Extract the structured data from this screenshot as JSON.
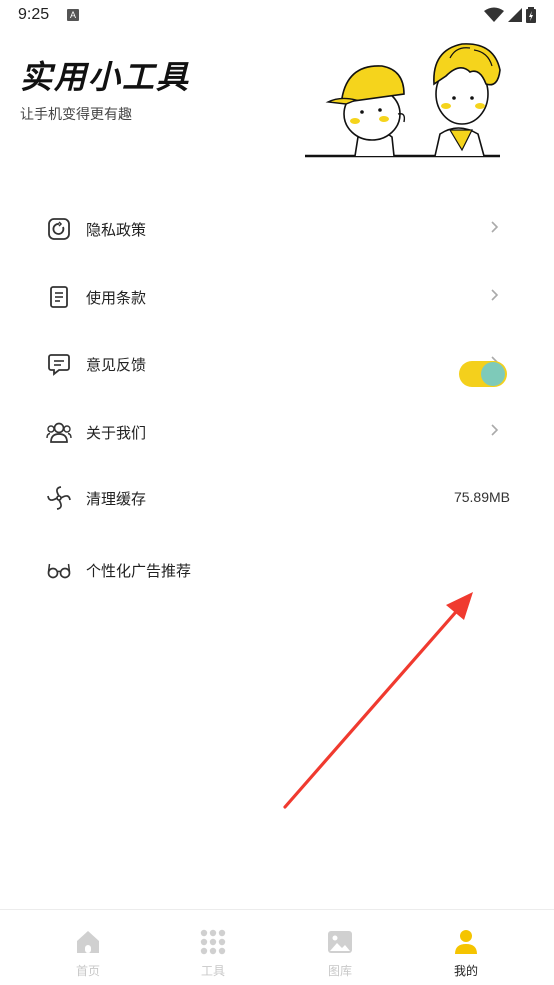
{
  "status_bar": {
    "time": "9:25",
    "notification_badge": "A"
  },
  "header": {
    "title": "实用小工具",
    "subtitle": "让手机变得更有趣"
  },
  "menu": {
    "items": [
      {
        "label": "隐私政策",
        "icon": "instagram-like-icon",
        "has_chevron": true
      },
      {
        "label": "使用条款",
        "icon": "document-icon",
        "has_chevron": true
      },
      {
        "label": "意见反馈",
        "icon": "message-icon",
        "has_chevron": true
      },
      {
        "label": "关于我们",
        "icon": "people-icon",
        "has_chevron": true
      },
      {
        "label": "清理缓存",
        "icon": "fan-icon",
        "value": "75.89MB"
      },
      {
        "label": "个性化广告推荐",
        "icon": "glasses-icon",
        "toggle_on": true
      }
    ]
  },
  "tab_bar": {
    "tabs": [
      {
        "label": "首页",
        "icon": "home-icon",
        "active": false
      },
      {
        "label": "工具",
        "icon": "grid-icon",
        "active": false
      },
      {
        "label": "图库",
        "icon": "image-icon",
        "active": false
      },
      {
        "label": "我的",
        "icon": "person-icon",
        "active": true
      }
    ]
  },
  "colors": {
    "accent_yellow": "#f4d01c",
    "toggle_knob": "#7ecab9",
    "arrow_red": "#f03a2f"
  }
}
